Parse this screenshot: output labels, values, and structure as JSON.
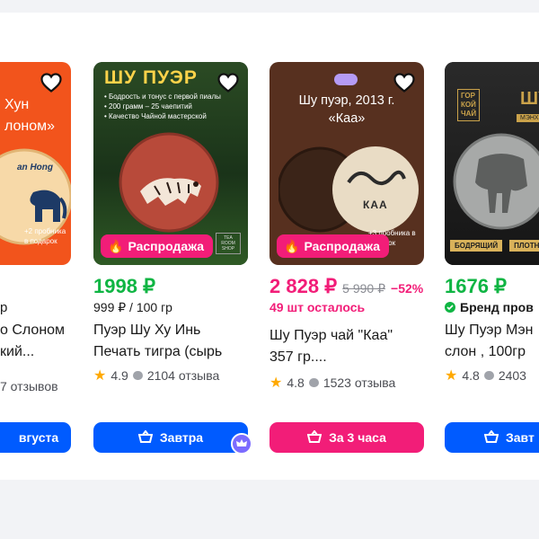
{
  "cards": [
    {
      "image": {
        "lines": [
          "Хун",
          "лоном»"
        ],
        "logo": "an Hong",
        "promo": "+2 пробника в подарок"
      },
      "sub": "р",
      "title_lines": [
        "о Слоном",
        "кий..."
      ],
      "reviews": "7 отзывов",
      "button": "вгуста"
    },
    {
      "image": {
        "title": "ШУ ПУЭР",
        "bullets": [
          "• Бодрость и тонус с первой пиалы",
          "• 200 грамм – 25 чаепитий",
          "• Качество Чайной мастерской"
        ],
        "shop_tag": "TEA ROOM SHOP",
        "badge": "Распродажа"
      },
      "price": "1998 ₽",
      "unit_price": "999 ₽ / 100 гр",
      "title_lines": [
        "Пуэр Шу Ху Инь",
        "Печать тигра (сырь"
      ],
      "rating": "4.9",
      "reviews": "2104 отзыва",
      "button": "Завтра"
    },
    {
      "image": {
        "title_lines": [
          "Шу пуэр, 2013 г.",
          "«Каа»"
        ],
        "logo": "КАА",
        "promo": "+3 пробника в подарок",
        "badge": "Распродажа"
      },
      "price": "2 828 ₽",
      "old_price": "5 990 ₽",
      "discount": "−52%",
      "stock": "49 шт осталось",
      "title_lines": [
        "Шу Пуэр чай \"Каа\"",
        "357 гр...."
      ],
      "rating": "4.8",
      "reviews": "1523 отзыва",
      "button": "За 3 часа"
    },
    {
      "image": {
        "brand_lines": [
          "ГОР",
          "КОЙ",
          "ЧАЙ"
        ],
        "label": "ШУ",
        "sublabel": "МЭНХ",
        "tags": [
          "БОДРЯЩИЙ",
          "ПЛОТНЫ"
        ]
      },
      "price": "1676 ₽",
      "brand": "Бренд пров",
      "title_lines": [
        "Шу Пуэр Мэн",
        "слон , 100гр"
      ],
      "rating": "4.8",
      "reviews": "2403",
      "button": "Завт"
    }
  ],
  "colors": {
    "price_green": "#0fb543",
    "accent_pink": "#f21d78",
    "button_blue": "#005bff"
  }
}
